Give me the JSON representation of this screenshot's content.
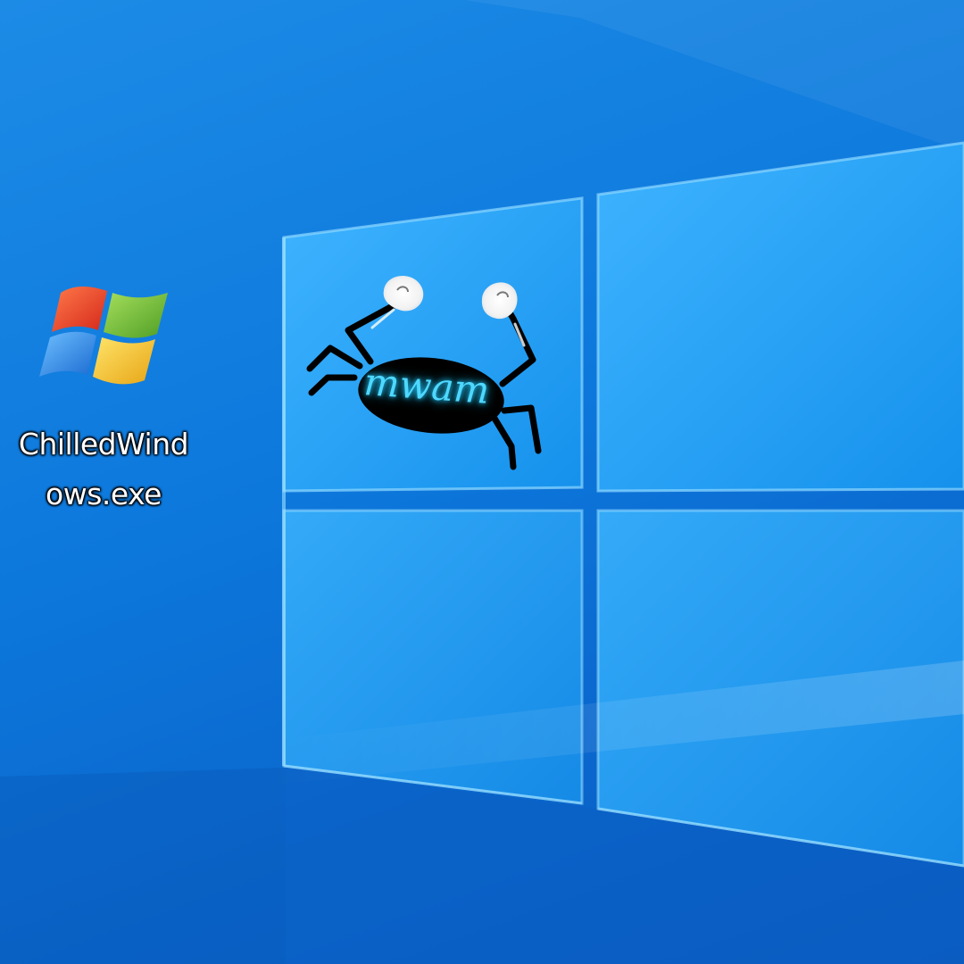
{
  "desktop": {
    "icons": [
      {
        "label_line1": "ChilledWind",
        "label_line2": "ows.exe",
        "icon": "windows-flag-icon"
      }
    ],
    "sticker": {
      "icon": "crab-icon",
      "text": "mwam"
    }
  },
  "colors": {
    "background": "#0d78dc",
    "window_pane": "#2ea6f5",
    "flag_red": "#e8412c",
    "flag_green": "#7cc242",
    "flag_blue": "#2f8ee8",
    "flag_yellow": "#f7c22a",
    "crab_glow": "#4fd8ff"
  }
}
